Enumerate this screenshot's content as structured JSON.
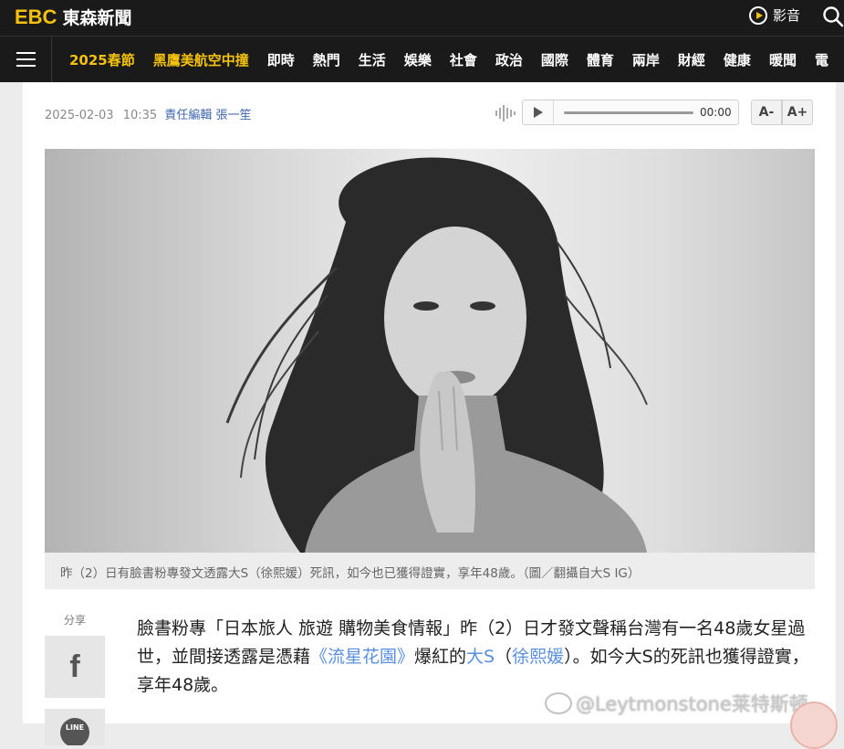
{
  "header": {
    "logo_ebc": "EBC",
    "logo_name": "東森新聞",
    "video_label": "影音"
  },
  "nav": {
    "items": [
      {
        "label": "2025春節",
        "highlight": true
      },
      {
        "label": "黑鷹美航空中撞",
        "highlight": true
      },
      {
        "label": "即時",
        "highlight": false
      },
      {
        "label": "熱門",
        "highlight": false
      },
      {
        "label": "生活",
        "highlight": false
      },
      {
        "label": "娛樂",
        "highlight": false
      },
      {
        "label": "社會",
        "highlight": false
      },
      {
        "label": "政治",
        "highlight": false
      },
      {
        "label": "國際",
        "highlight": false
      },
      {
        "label": "體育",
        "highlight": false
      },
      {
        "label": "兩岸",
        "highlight": false
      },
      {
        "label": "財經",
        "highlight": false
      },
      {
        "label": "健康",
        "highlight": false
      },
      {
        "label": "暖聞",
        "highlight": false
      },
      {
        "label": "電",
        "highlight": false
      }
    ]
  },
  "article": {
    "date": "2025-02-03",
    "time": "10:35",
    "editor": "責任編輯 張一笙",
    "audio_time": "00:00",
    "font_minus": "A-",
    "font_plus": "A+",
    "caption": "昨（2）日有臉書粉專發文透露大S（徐熙媛）死訊，如今也已獲得證實，享年48歲。（圖／翻攝自大S IG）",
    "share_label": "分享",
    "facebook_glyph": "f",
    "line_label": "LINE",
    "body": {
      "p1": "臉書粉專「日本旅人 旅遊 購物美食情報」昨（2）日才發文聲稱台灣有一名48歲女星過世，並間接透露是憑藉",
      "link_drama": "《流星花園》",
      "p2": "爆紅的",
      "link_bigs": "大S",
      "p3": "（",
      "link_name": "徐熙媛",
      "p4": "）。如今大S的死訊也獲得證實，享年48歲。"
    }
  },
  "watermark": "@Leytmonstone莱特斯顿",
  "colors": {
    "brand_yellow": "#f4c20d",
    "header_bg": "#1a1a1a",
    "link_blue": "#5a8fe0",
    "editor_blue": "#3f66b0"
  }
}
